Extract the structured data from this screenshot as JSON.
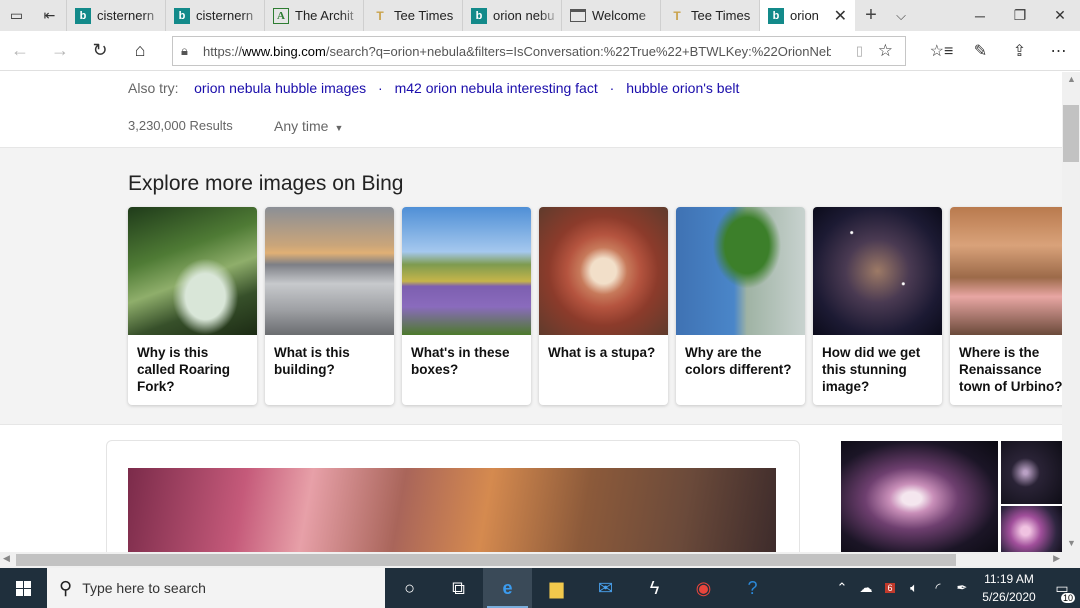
{
  "tabs": [
    {
      "label": "cisternern",
      "favicon": "bing",
      "active": false
    },
    {
      "label": "cisternern",
      "favicon": "bing",
      "active": false
    },
    {
      "label": "The Archit",
      "favicon": "archit",
      "active": false
    },
    {
      "label": "Tee Times",
      "favicon": "tee",
      "active": false
    },
    {
      "label": "orion nebu",
      "favicon": "bing",
      "active": false
    },
    {
      "label": "Welcome",
      "favicon": "window",
      "active": false
    },
    {
      "label": "Tee Times",
      "favicon": "tee",
      "active": false
    },
    {
      "label": "orion",
      "favicon": "bing",
      "active": true
    }
  ],
  "address": {
    "prefix": "https://",
    "host": "www.bing.com",
    "rest": "/search?q=orion+nebula&filters=IsConversation:%22True%22+BTWLKey:%22OrionNebul"
  },
  "also_try": {
    "label": "Also try:",
    "links": [
      "orion nebula hubble images",
      "m42 orion nebula interesting fact",
      "hubble orion's belt"
    ]
  },
  "results": {
    "count": "3,230,000 Results",
    "time_filter": "Any time"
  },
  "explore": {
    "title": "Explore more images on Bing",
    "cards": [
      {
        "caption": "Why is this called Roaring Fork?"
      },
      {
        "caption": "What is this building?"
      },
      {
        "caption": "What's in these boxes?"
      },
      {
        "caption": "What is a stupa?"
      },
      {
        "caption": "Why are the colors different?"
      },
      {
        "caption": "How did we get this stunning image?"
      },
      {
        "caption": "Where is the Renaissance town of Urbino?"
      }
    ]
  },
  "taskbar": {
    "search_placeholder": "Type here to search",
    "time": "11:19 AM",
    "date": "5/26/2020",
    "notification_count": "10",
    "badge": "6"
  },
  "colors": {
    "link": "#1a0dab",
    "taskbar": "#1f2f3c",
    "tabbar": "#e6e6e6"
  }
}
